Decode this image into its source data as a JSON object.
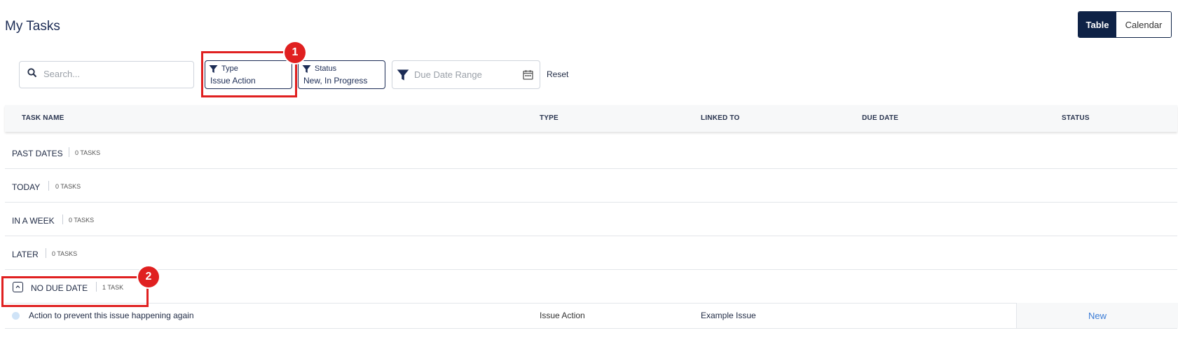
{
  "page": {
    "title": "My Tasks"
  },
  "view_toggle": {
    "table": "Table",
    "calendar": "Calendar"
  },
  "search": {
    "placeholder": "Search..."
  },
  "filters": {
    "type": {
      "label": "Type",
      "value": "Issue Action"
    },
    "status": {
      "label": "Status",
      "value": "New, In Progress"
    },
    "due_date": {
      "placeholder": "Due Date Range"
    },
    "reset": "Reset"
  },
  "annotations": {
    "badge1": "1",
    "badge2": "2"
  },
  "table": {
    "columns": [
      "TASK NAME",
      "TYPE",
      "LINKED TO",
      "DUE DATE",
      "STATUS"
    ],
    "groups": [
      {
        "name": "PAST DATES",
        "count": "0 TASKS"
      },
      {
        "name": "TODAY",
        "count": "0 TASKS"
      },
      {
        "name": "IN A WEEK",
        "count": "0 TASKS"
      },
      {
        "name": "LATER",
        "count": "0 TASKS"
      },
      {
        "name": "NO DUE DATE",
        "count": "1 TASK"
      }
    ],
    "rows": [
      {
        "name": "Action to prevent this issue happening again",
        "type": "Issue Action",
        "linked_to": "Example Issue",
        "status": "New"
      }
    ]
  },
  "colors": {
    "primary": "#0e2246",
    "highlight": "#e02020",
    "link": "#3a7bd5"
  }
}
